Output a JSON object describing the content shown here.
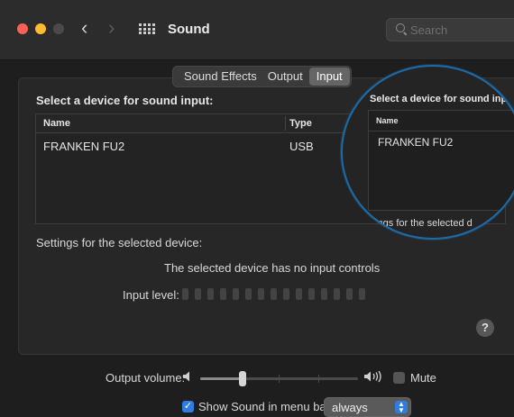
{
  "window": {
    "title": "Sound",
    "search_placeholder": "Search",
    "back_glyph": "‹",
    "forward_glyph": "›"
  },
  "tabs": [
    {
      "label": "Sound Effects",
      "active": false
    },
    {
      "label": "Output",
      "active": false
    },
    {
      "label": "Input",
      "active": true
    }
  ],
  "input": {
    "section_title": "Select a device for sound input:",
    "columns": {
      "name": "Name",
      "type": "Type"
    },
    "devices": [
      {
        "name": "FRANKEN FU2",
        "type": "USB"
      }
    ],
    "settings_label": "Settings for the selected device:",
    "no_controls_text": "The selected device has no input controls",
    "input_level_label": "Input level:",
    "input_level_segments": 15,
    "help_label": "?"
  },
  "magnifier": {
    "title": "Select a device for sound inp",
    "column_name": "Name",
    "device_name": "FRANKEN FU2",
    "settings_text": "ttings for the selected d",
    "ring_color": "#1e6aa5"
  },
  "output": {
    "volume_label": "Output volume:",
    "volume_fraction": 0.27,
    "mute_label": "Mute",
    "mute_checked": false
  },
  "menubar": {
    "show_label": "Show Sound in menu bar",
    "checked": true,
    "mode_value": "always"
  },
  "colors": {
    "accent": "#2f7de1",
    "close": "#fe5f57",
    "minimize": "#febc2e"
  }
}
